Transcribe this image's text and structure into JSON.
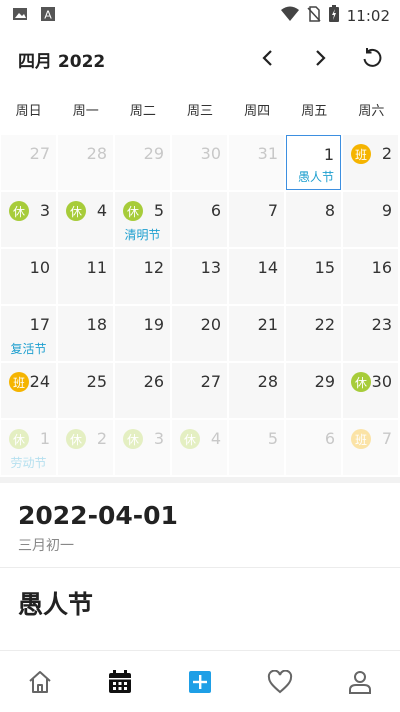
{
  "status_bar": {
    "time": "11:02"
  },
  "header": {
    "month_title": "四月 2022"
  },
  "weekdays": [
    "周日",
    "周一",
    "周二",
    "周三",
    "周四",
    "周五",
    "周六"
  ],
  "calendar": {
    "days": [
      {
        "day": "27",
        "other": true,
        "badge": "",
        "fest": ""
      },
      {
        "day": "28",
        "other": true,
        "badge": "",
        "fest": ""
      },
      {
        "day": "29",
        "other": true,
        "badge": "",
        "fest": ""
      },
      {
        "day": "30",
        "other": true,
        "badge": "",
        "fest": ""
      },
      {
        "day": "31",
        "other": true,
        "badge": "",
        "fest": ""
      },
      {
        "day": "1",
        "other": false,
        "badge": "",
        "fest": "愚人节",
        "selected": true
      },
      {
        "day": "2",
        "other": false,
        "badge": "班",
        "fest": ""
      },
      {
        "day": "3",
        "other": false,
        "badge": "休",
        "fest": ""
      },
      {
        "day": "4",
        "other": false,
        "badge": "休",
        "fest": ""
      },
      {
        "day": "5",
        "other": false,
        "badge": "休",
        "fest": "清明节"
      },
      {
        "day": "6",
        "other": false,
        "badge": "",
        "fest": ""
      },
      {
        "day": "7",
        "other": false,
        "badge": "",
        "fest": ""
      },
      {
        "day": "8",
        "other": false,
        "badge": "",
        "fest": ""
      },
      {
        "day": "9",
        "other": false,
        "badge": "",
        "fest": ""
      },
      {
        "day": "10",
        "other": false,
        "badge": "",
        "fest": ""
      },
      {
        "day": "11",
        "other": false,
        "badge": "",
        "fest": ""
      },
      {
        "day": "12",
        "other": false,
        "badge": "",
        "fest": ""
      },
      {
        "day": "13",
        "other": false,
        "badge": "",
        "fest": ""
      },
      {
        "day": "14",
        "other": false,
        "badge": "",
        "fest": ""
      },
      {
        "day": "15",
        "other": false,
        "badge": "",
        "fest": ""
      },
      {
        "day": "16",
        "other": false,
        "badge": "",
        "fest": ""
      },
      {
        "day": "17",
        "other": false,
        "badge": "",
        "fest": "复活节"
      },
      {
        "day": "18",
        "other": false,
        "badge": "",
        "fest": ""
      },
      {
        "day": "19",
        "other": false,
        "badge": "",
        "fest": ""
      },
      {
        "day": "20",
        "other": false,
        "badge": "",
        "fest": ""
      },
      {
        "day": "21",
        "other": false,
        "badge": "",
        "fest": ""
      },
      {
        "day": "22",
        "other": false,
        "badge": "",
        "fest": ""
      },
      {
        "day": "23",
        "other": false,
        "badge": "",
        "fest": ""
      },
      {
        "day": "24",
        "other": false,
        "badge": "班",
        "fest": ""
      },
      {
        "day": "25",
        "other": false,
        "badge": "",
        "fest": ""
      },
      {
        "day": "26",
        "other": false,
        "badge": "",
        "fest": ""
      },
      {
        "day": "27",
        "other": false,
        "badge": "",
        "fest": ""
      },
      {
        "day": "28",
        "other": false,
        "badge": "",
        "fest": ""
      },
      {
        "day": "29",
        "other": false,
        "badge": "",
        "fest": ""
      },
      {
        "day": "30",
        "other": false,
        "badge": "休",
        "fest": ""
      },
      {
        "day": "1",
        "other": true,
        "badge": "休",
        "fest": "劳动节"
      },
      {
        "day": "2",
        "other": true,
        "badge": "休",
        "fest": ""
      },
      {
        "day": "3",
        "other": true,
        "badge": "休",
        "fest": ""
      },
      {
        "day": "4",
        "other": true,
        "badge": "休",
        "fest": ""
      },
      {
        "day": "5",
        "other": true,
        "badge": "",
        "fest": ""
      },
      {
        "day": "6",
        "other": true,
        "badge": "",
        "fest": ""
      },
      {
        "day": "7",
        "other": true,
        "badge": "班",
        "fest": ""
      }
    ]
  },
  "detail": {
    "date": "2022-04-01",
    "lunar": "三月初一",
    "festival": "愚人节"
  },
  "bottom_nav": [
    {
      "name": "home",
      "icon": "home-icon"
    },
    {
      "name": "calendar",
      "icon": "calendar-icon",
      "active": true
    },
    {
      "name": "add",
      "icon": "plus-square-icon"
    },
    {
      "name": "favorites",
      "icon": "heart-icon"
    },
    {
      "name": "profile",
      "icon": "person-icon"
    }
  ],
  "colors": {
    "accent": "#1e9fcf",
    "selected_border": "#3d8fe0",
    "rest_badge": "#a7cc3a",
    "work_badge": "#f5b400",
    "add_button": "#1e9fe6"
  }
}
